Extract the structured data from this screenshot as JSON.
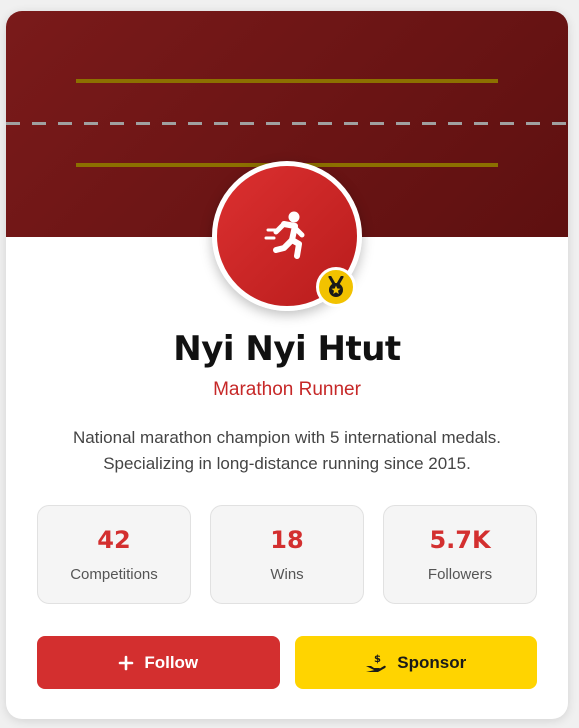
{
  "profile": {
    "name": "Nyi Nyi Htut",
    "role": "Marathon Runner",
    "bio_line1": "National marathon champion with 5 international medals.",
    "bio_line2": "Specializing in long-distance running since 2015.",
    "avatar_icon": "running-person-icon",
    "badge_icon": "medal-icon"
  },
  "stats": [
    {
      "value": "42",
      "label": "Competitions"
    },
    {
      "value": "18",
      "label": "Wins"
    },
    {
      "value": "5.7K",
      "label": "Followers"
    }
  ],
  "actions": {
    "follow_label": "Follow",
    "follow_icon": "plus-icon",
    "sponsor_label": "Sponsor",
    "sponsor_icon": "hand-holding-dollar-icon"
  },
  "colors": {
    "banner": "#6e1515",
    "accent_red": "#d32f2f",
    "accent_yellow": "#ffd400",
    "lane_line": "#8c7000"
  }
}
